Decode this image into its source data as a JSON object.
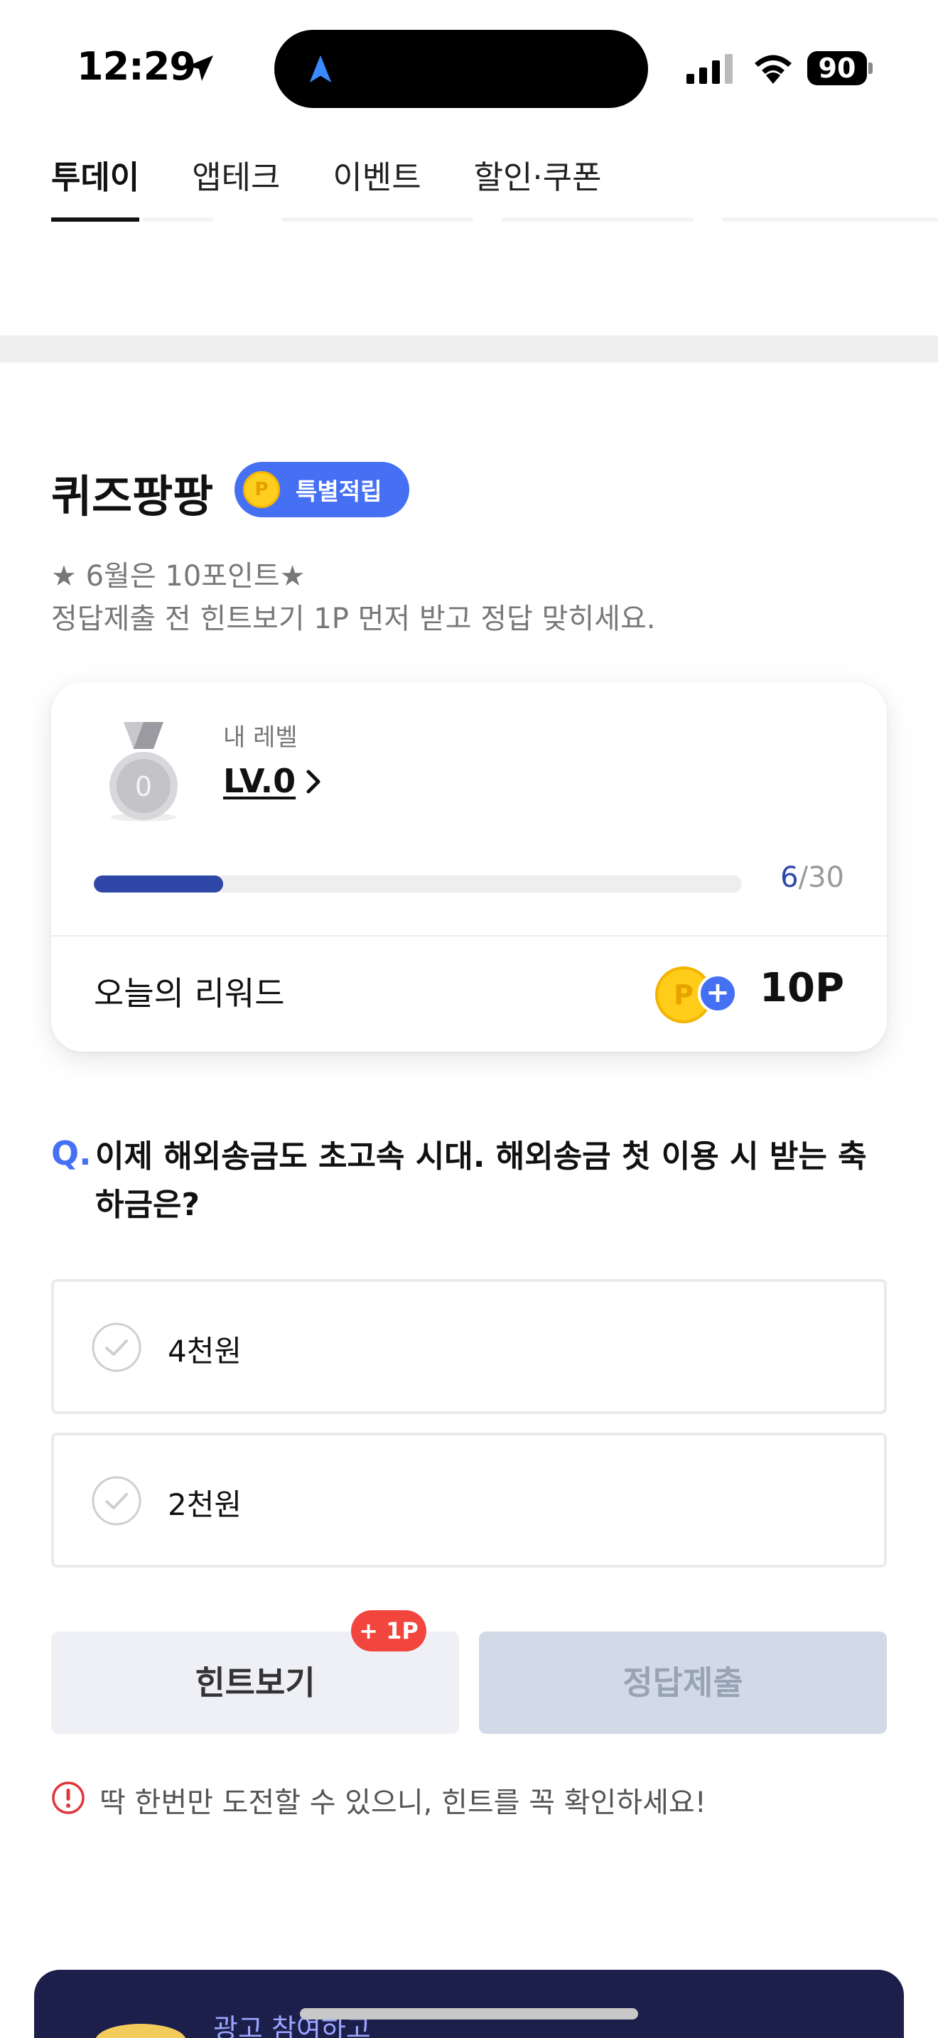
{
  "status_bar": {
    "time": "12:29",
    "battery": "90",
    "icons": [
      "location-arrow-icon",
      "navigation-icon",
      "cellular-signal-icon",
      "wifi-icon",
      "battery-icon"
    ]
  },
  "tabs": [
    {
      "label": "투데이",
      "active": true
    },
    {
      "label": "앱테크",
      "active": false
    },
    {
      "label": "이벤트",
      "active": false
    },
    {
      "label": "할인·쿠폰",
      "active": false
    }
  ],
  "quiz": {
    "title": "퀴즈팡팡",
    "badge_label": "특별적립",
    "badge_coin": "P",
    "description_line1": "★ 6월은 10포인트★",
    "description_line2": "정답제출 전 힌트보기 1P 먼저 받고 정답 맞히세요."
  },
  "level_card": {
    "level_label": "내 레벨",
    "level_value": "LV.0",
    "medal_number": "0",
    "progress_current": "6",
    "progress_separator": "/",
    "progress_total": "30",
    "progress_fraction": 0.2,
    "reward_label": "오늘의 리워드",
    "reward_coin": "P",
    "reward_plus": "+",
    "reward_value": "10P"
  },
  "question": {
    "marker": "Q.",
    "text": "이제 해외송금도 초고속 시대. 해외송금 첫 이용 시 받는 축하금은?"
  },
  "options": [
    {
      "label": "4천원"
    },
    {
      "label": "2천원"
    }
  ],
  "buttons": {
    "hint_label": "힌트보기",
    "hint_bonus": "+ 1P",
    "submit_label": "정답제출"
  },
  "warning": {
    "text": "딱 한번만 도전할 수 있으니, 힌트를 꼭 확인하세요!"
  },
  "ad_banner": {
    "text": "광고 참여하고"
  },
  "colors": {
    "accent_blue": "#4670f4",
    "progress_blue": "#2f47a6",
    "coin_yellow": "#ffcc1a",
    "bonus_red": "#f2453d",
    "ad_navy": "#1c1f4a"
  }
}
